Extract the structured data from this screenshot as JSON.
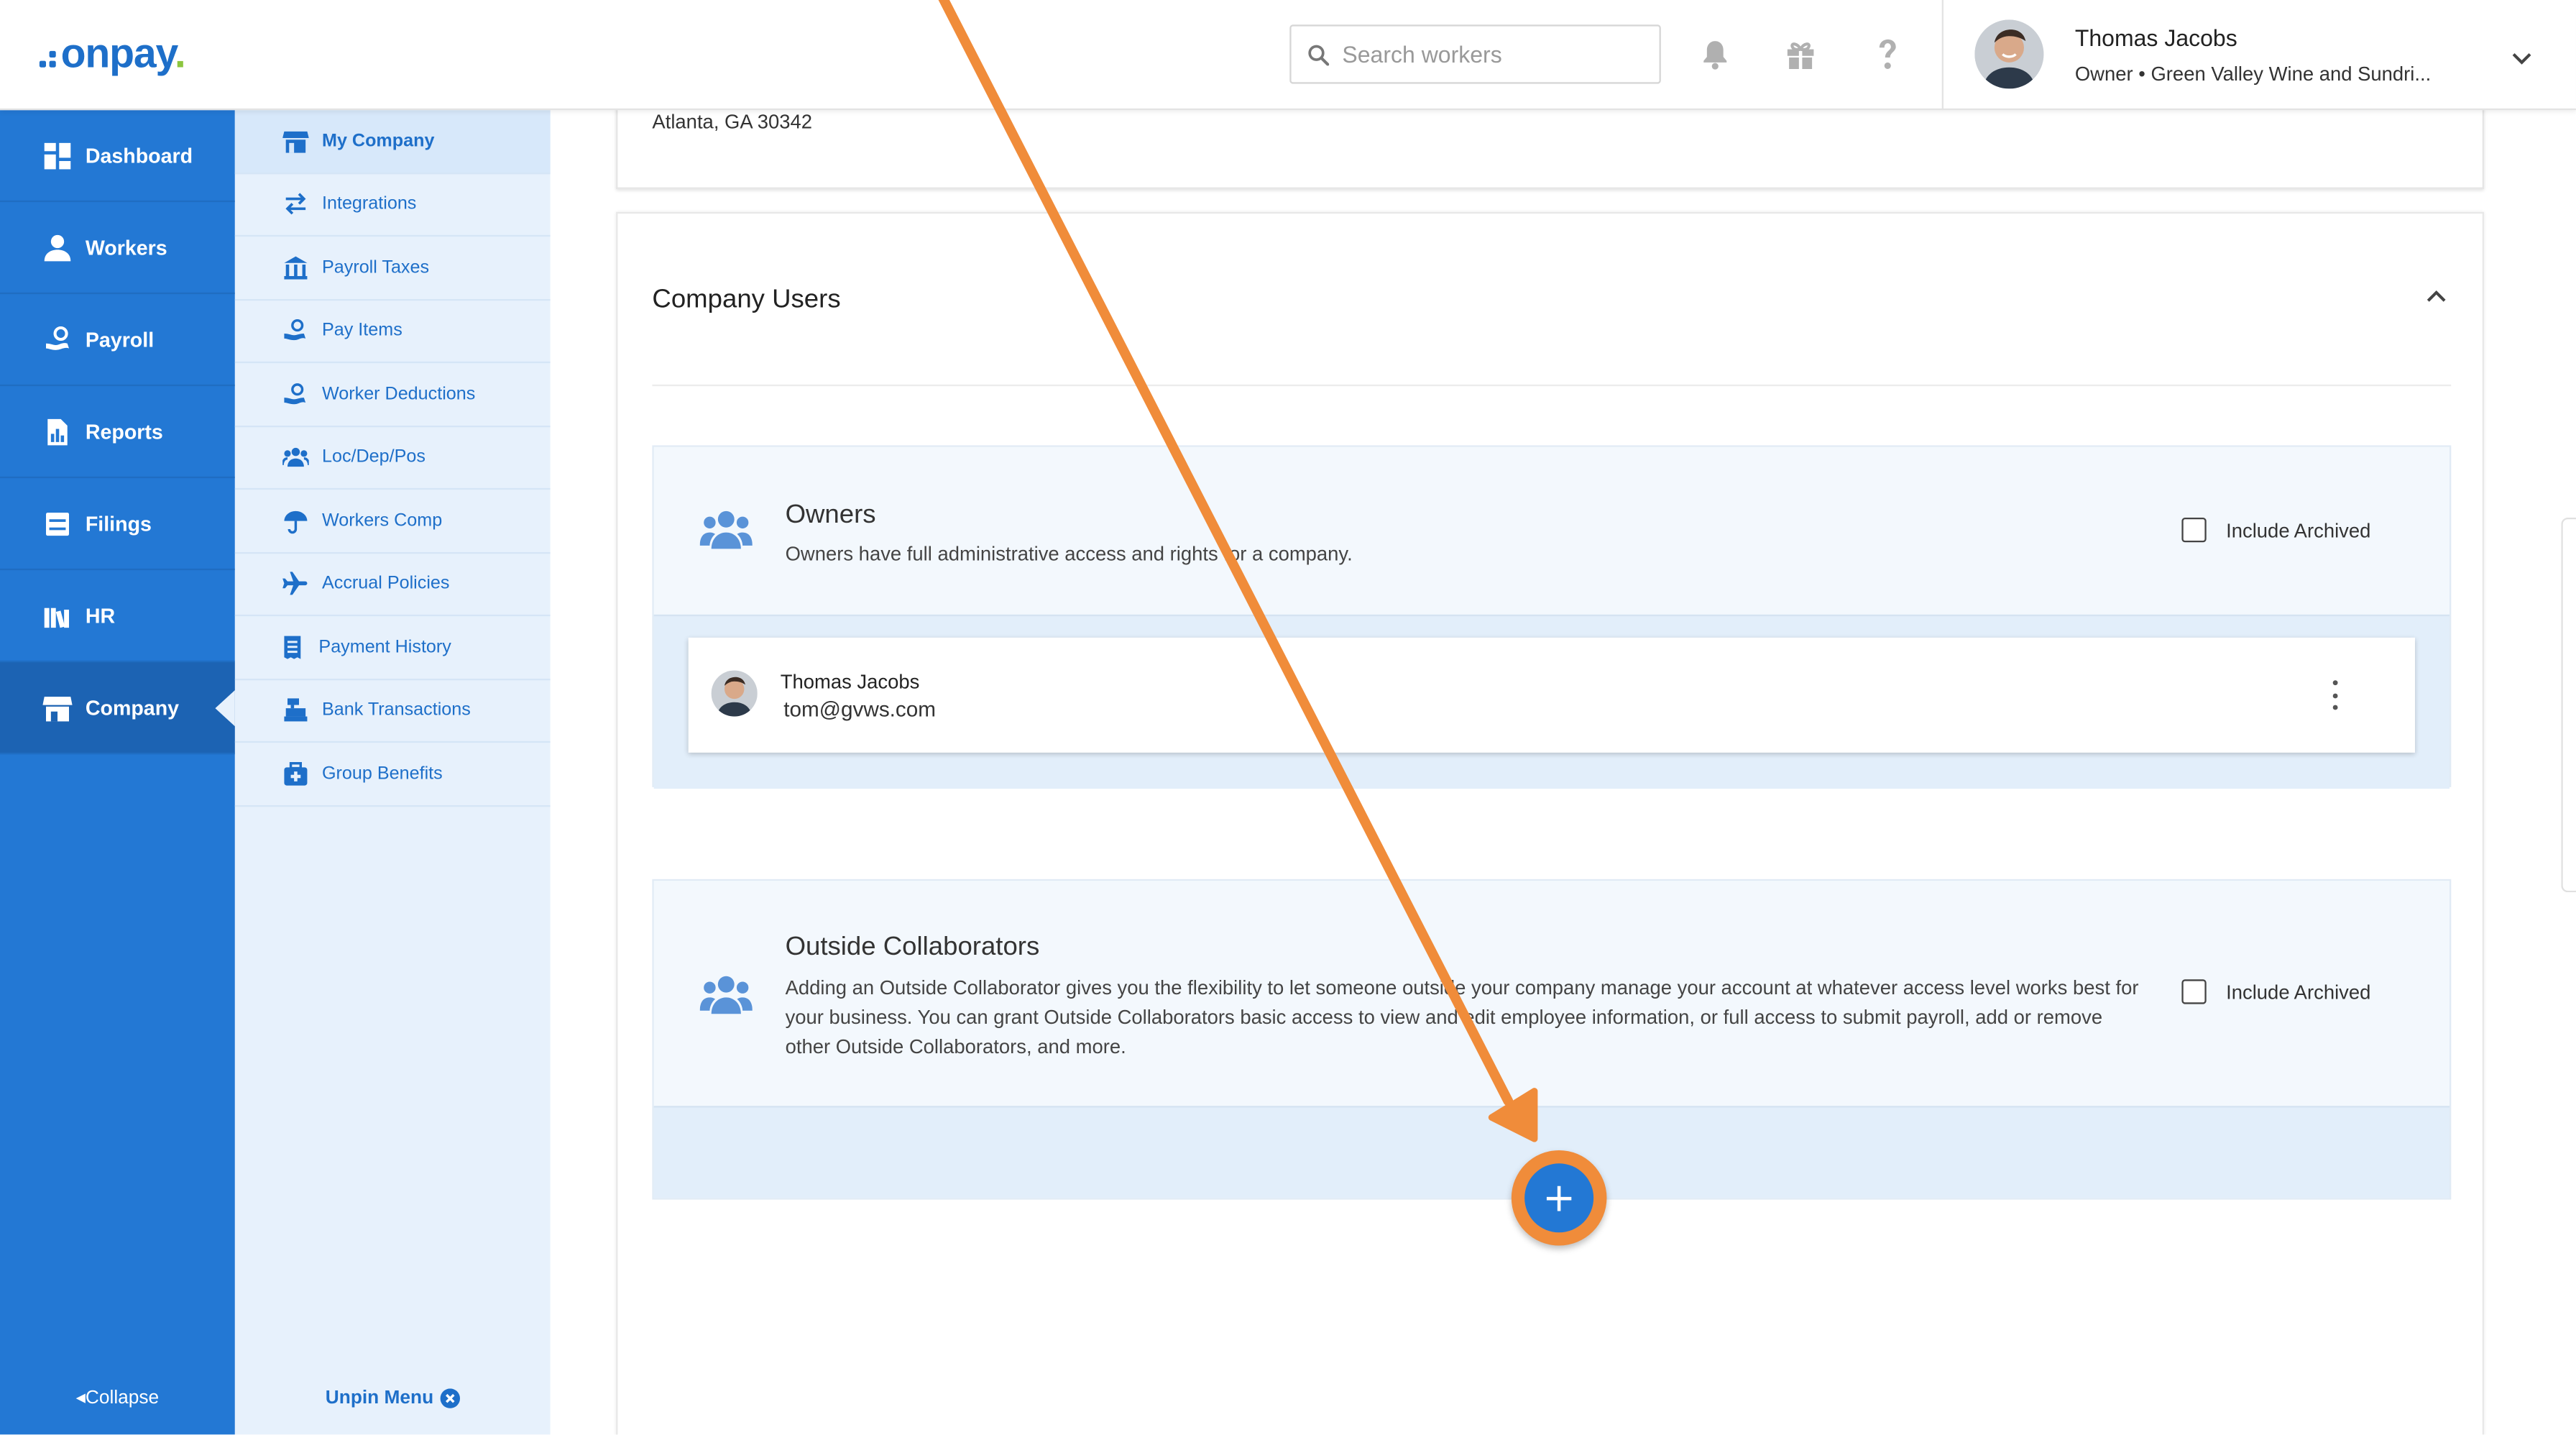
{
  "brand": {
    "name": "onpay",
    "dot": ".",
    "logo_color": "#1e6fc9",
    "dot_color": "#8cc63f"
  },
  "header": {
    "search_placeholder": "Search workers",
    "icons": [
      "bell-icon",
      "gift-icon",
      "help-icon"
    ],
    "user": {
      "name": "Thomas Jacobs",
      "role": "Owner • Green Valley Wine and Sundri..."
    }
  },
  "sidebar": {
    "items": [
      {
        "label": "Dashboard",
        "icon": "dashboard-icon"
      },
      {
        "label": "Workers",
        "icon": "workers-icon"
      },
      {
        "label": "Payroll",
        "icon": "payroll-icon"
      },
      {
        "label": "Reports",
        "icon": "reports-icon"
      },
      {
        "label": "Filings",
        "icon": "filings-icon"
      },
      {
        "label": "HR",
        "icon": "hr-icon"
      },
      {
        "label": "Company",
        "icon": "company-icon",
        "active": true
      }
    ],
    "collapse_label": "Collapse"
  },
  "subnav": {
    "items": [
      {
        "label": "My Company",
        "active": true
      },
      {
        "label": "Integrations"
      },
      {
        "label": "Payroll Taxes"
      },
      {
        "label": "Pay Items"
      },
      {
        "label": "Worker Deductions"
      },
      {
        "label": "Loc/Dep/Pos"
      },
      {
        "label": "Workers Comp"
      },
      {
        "label": "Accrual Policies"
      },
      {
        "label": "Payment History"
      },
      {
        "label": "Bank Transactions"
      },
      {
        "label": "Group Benefits"
      }
    ],
    "unpin_label": "Unpin Menu"
  },
  "main": {
    "address_line": "Atlanta, GA 30342",
    "company_users": {
      "title": "Company Users",
      "owners": {
        "title": "Owners",
        "description": "Owners have full administrative access and rights for a company.",
        "include_archived": "Include Archived",
        "users": [
          {
            "name": "Thomas Jacobs",
            "email": "tom@gvws.com"
          }
        ]
      },
      "collaborators": {
        "title": "Outside Collaborators",
        "description": "Adding an Outside Collaborator gives you the flexibility to let someone outside your company manage your account at whatever access level works best for your business. You can grant Outside Collaborators basic access to view and edit employee information, or full access to submit payroll, add or remove other Outside Collaborators, and more.",
        "include_archived": "Include Archived",
        "add_label": "+"
      }
    }
  },
  "colors": {
    "primary": "#2378d4",
    "primary_dark": "#1c63b3",
    "subnav_bg": "#e7f1fc",
    "highlight": "#f08c3a"
  }
}
